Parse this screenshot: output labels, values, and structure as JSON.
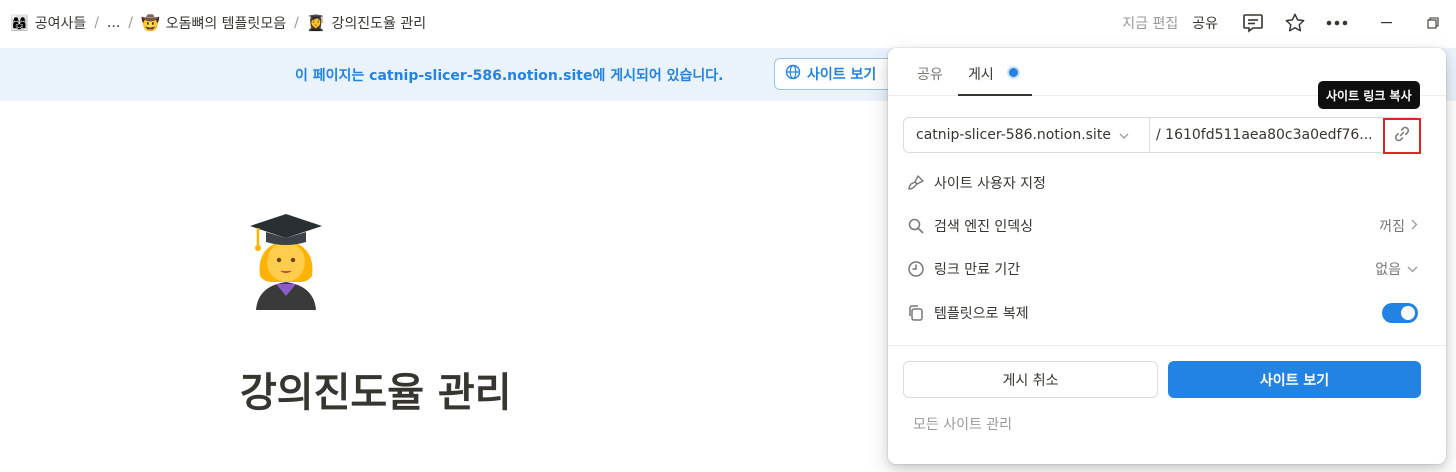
{
  "breadcrumb": {
    "items": [
      {
        "icon": "group-emoji",
        "emoji": "👩‍👩‍👧",
        "label": "공여사들"
      },
      {
        "label": "..."
      },
      {
        "icon": "smile-emoji",
        "emoji": "🤠",
        "label": "오돔뼈의 템플릿모음"
      },
      {
        "icon": "student-emoji",
        "emoji": "👩‍🎓",
        "label": "강의진도율 관리"
      }
    ],
    "separator": "/"
  },
  "topbar": {
    "edited_label": "지금 편집",
    "share_label": "공유"
  },
  "banner": {
    "text": "이 페이지는 catnip-slicer-586.notion.site에 게시되어 있습니다.",
    "button_label": "사이트 보기"
  },
  "page": {
    "icon": "woman-student-emoji",
    "title": "강의진도율 관리"
  },
  "popover": {
    "tabs": [
      {
        "label": "공유"
      },
      {
        "label": "게시"
      }
    ],
    "domain": "catnip-slicer-586.notion.site",
    "slug": "/ 1610fd511aea80c3a0edf76...",
    "copy_tooltip": "사이트 링크 복사",
    "options": [
      {
        "label": "사이트 사용자 지정",
        "icon": "paintbrush-icon"
      },
      {
        "label": "검색 엔진 인덱싱",
        "icon": "search-icon",
        "value": "꺼짐"
      },
      {
        "label": "링크 만료 기간",
        "icon": "clock-icon",
        "value": "없음"
      },
      {
        "label": "템플릿으로 복제",
        "icon": "duplicate-icon",
        "enabled": true
      }
    ],
    "unpublish_label": "게시 취소",
    "view_site_label": "사이트 보기",
    "manage_label": "모든 사이트 관리"
  },
  "colors": {
    "accent": "#2383e2",
    "banner_bg": "#eaf3fb",
    "highlight": "#e02424"
  }
}
